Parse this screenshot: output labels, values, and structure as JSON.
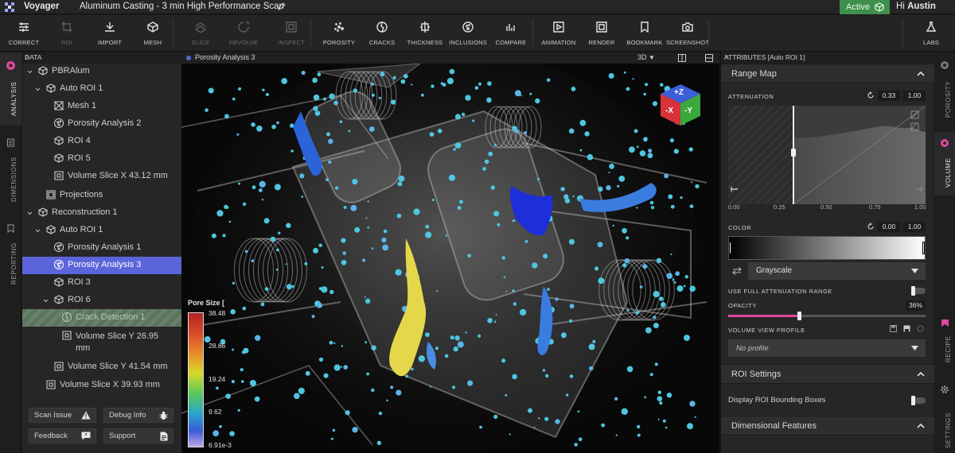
{
  "app": {
    "name": "Voyager",
    "document_title": "Aluminum Casting - 3 min High Performance Scan",
    "status": "Active",
    "greeting_prefix": "Hi",
    "user": "Austin"
  },
  "toolbar": {
    "items": [
      {
        "label": "CORRECT",
        "icon": "sliders-icon",
        "disabled": false
      },
      {
        "label": "ROI",
        "icon": "crop-icon",
        "disabled": true
      },
      {
        "label": "IMPORT",
        "icon": "import-icon",
        "disabled": false
      },
      {
        "label": "MESH",
        "icon": "mesh-icon",
        "disabled": false
      },
      {
        "label": "SLICE",
        "icon": "slice-icon",
        "disabled": true
      },
      {
        "label": "REVOLVE",
        "icon": "revolve-icon",
        "disabled": true
      },
      {
        "label": "INSPECT",
        "icon": "inspect-icon",
        "disabled": true
      },
      {
        "label": "POROSITY",
        "icon": "porosity-icon",
        "disabled": false
      },
      {
        "label": "CRACKS",
        "icon": "cracks-icon",
        "disabled": false
      },
      {
        "label": "THICKNESS",
        "icon": "thickness-icon",
        "disabled": false
      },
      {
        "label": "INCLUSIONS",
        "icon": "inclusions-icon",
        "disabled": false
      },
      {
        "label": "COMPARE",
        "icon": "compare-icon",
        "disabled": false
      },
      {
        "label": "ANIMATION",
        "icon": "animation-icon",
        "disabled": false
      },
      {
        "label": "RENDER",
        "icon": "render-icon",
        "disabled": false
      },
      {
        "label": "BOOKMARK",
        "icon": "bookmark-icon",
        "disabled": false
      },
      {
        "label": "SCREENSHOT",
        "icon": "camera-icon",
        "disabled": false
      },
      {
        "label": "LABS",
        "icon": "flask-icon",
        "disabled": false
      }
    ]
  },
  "left_tabs": [
    {
      "label": "ANALYSIS",
      "icon": "analysis-icon",
      "active": true
    },
    {
      "label": "DIMENSIONS",
      "icon": "dimensions-icon",
      "active": false
    },
    {
      "label": "REPORTING",
      "icon": "reporting-icon",
      "active": false
    }
  ],
  "data_panel": {
    "title": "DATA",
    "tree": [
      {
        "label": "PBRAlum",
        "icon": "cube-icon",
        "expanded": true
      },
      {
        "label": "Auto ROI 1",
        "icon": "cube-icon",
        "expanded": true
      },
      {
        "label": "Mesh 1",
        "icon": "mesh-node-icon"
      },
      {
        "label": "Porosity Analysis 2",
        "icon": "porosity-node-icon"
      },
      {
        "label": "ROI 4",
        "icon": "cube-icon"
      },
      {
        "label": "ROI 5",
        "icon": "cube-icon"
      },
      {
        "label": "Volume Slice X 43.12 mm",
        "icon": "slice-node-icon"
      },
      {
        "label": "Projections",
        "icon": "projections-icon"
      },
      {
        "label": "Reconstruction 1",
        "icon": "cube-icon",
        "expanded": true
      },
      {
        "label": "Auto ROI 1",
        "icon": "cube-icon",
        "expanded": true
      },
      {
        "label": "Porosity Analysis 1",
        "icon": "porosity-node-icon"
      },
      {
        "label": "Porosity Analysis 3",
        "icon": "porosity-node-icon",
        "selected": true
      },
      {
        "label": "ROI 3",
        "icon": "cube-icon"
      },
      {
        "label": "ROI 6",
        "icon": "cube-icon",
        "expanded": true
      },
      {
        "label": "Crack Detection 1",
        "icon": "crack-node-icon",
        "status": "processing"
      },
      {
        "label": "Volume Slice Y 26.95 mm",
        "icon": "slice-node-icon"
      },
      {
        "label": "Volume Slice Y 41.54 mm",
        "icon": "slice-node-icon"
      },
      {
        "label": "Volume Slice X 39.93 mm",
        "icon": "slice-node-icon"
      }
    ],
    "buttons": {
      "scan_issue": "Scan Issue",
      "debug_info": "Debug Info",
      "feedback": "Feedback",
      "support": "Support"
    }
  },
  "viewer": {
    "title": "Porosity Analysis 3",
    "view_mode": "3D",
    "orientation_cube": {
      "top": "+Z",
      "left": "-X",
      "right": "-Y"
    },
    "legend": {
      "title": "Pore Size [",
      "ticks": [
        "38.48",
        "28.86",
        "19.24",
        "9.62",
        "6.91e-3"
      ]
    }
  },
  "attributes": {
    "title": "ATTRIBUTES [Auto ROI 1]",
    "range_map": {
      "title": "Range Map",
      "attenuation_label": "ATTENUATION",
      "attenuation_min": "0.33",
      "attenuation_max": "1.00",
      "axis_ticks": [
        "0.00",
        "0.25",
        "0.50",
        "0.75",
        "1.00"
      ],
      "color_label": "COLOR",
      "color_min": "0.00",
      "color_max": "1.00",
      "colormap": "Grayscale",
      "full_range_label": "USE FULL ATTENUATION RANGE",
      "opacity_label": "OPACITY",
      "opacity_value": "36%",
      "opacity_fraction": 0.36,
      "profile_label": "VOLUME VIEW PROFILE",
      "profile_value": "No profile"
    },
    "roi_settings": {
      "title": "ROI Settings",
      "bounding_boxes_label": "Display ROI Bounding Boxes"
    },
    "dimensional_features": {
      "title": "Dimensional Features"
    }
  },
  "right_tabs": [
    {
      "label": "POROSITY",
      "icon": "porosity-tab-icon",
      "active": false
    },
    {
      "label": "VOLUME",
      "icon": "volume-tab-icon",
      "active": true
    },
    {
      "label": "RECIPE",
      "icon": "recipe-tab-icon",
      "active": false
    },
    {
      "label": "SETTINGS",
      "icon": "gear-icon",
      "active": false
    }
  ],
  "colors": {
    "accent": "#5b64d8",
    "active_green": "#3f8f4e",
    "opacity_pink": "#e0489e",
    "pore_cyan": "#4ec6e0",
    "pore_blue": "#3a5ad8",
    "pore_yellow": "#e4d84a"
  }
}
